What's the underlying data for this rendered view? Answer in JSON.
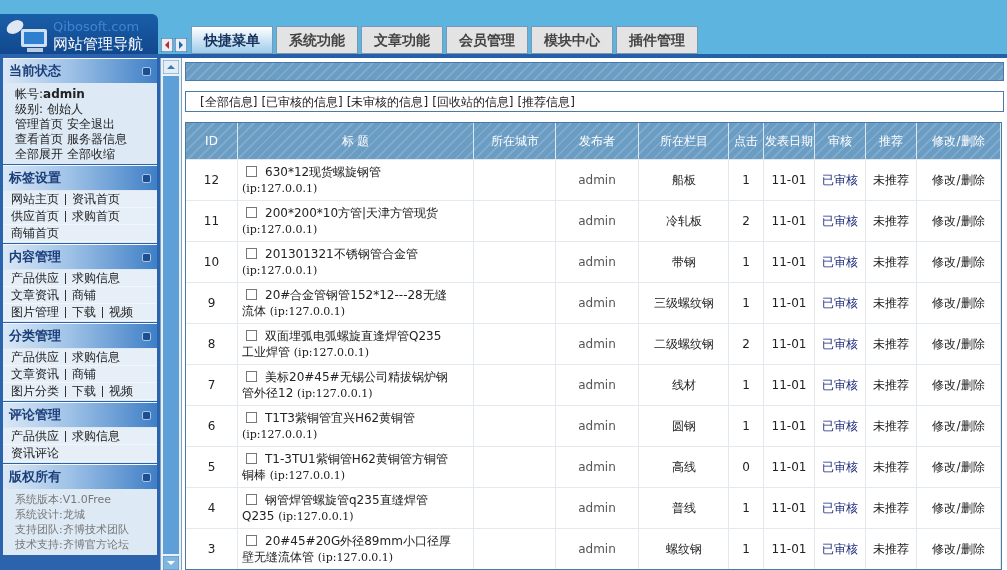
{
  "logo": {
    "site": "Qibosoft.com",
    "title": "网站管理导航"
  },
  "tabs": [
    {
      "label": "快捷菜单",
      "selected": true
    },
    {
      "label": "系统功能",
      "selected": false
    },
    {
      "label": "文章功能",
      "selected": false
    },
    {
      "label": "会员管理",
      "selected": false
    },
    {
      "label": "模块中心",
      "selected": false
    },
    {
      "label": "插件管理",
      "selected": false
    }
  ],
  "sidebar": [
    {
      "title": "当前状态",
      "kind": "info",
      "lines": [
        [
          "帐号:**admin**"
        ],
        [
          "级别: 创始人"
        ],
        [
          "管理首页",
          "安全退出"
        ],
        [
          "查看首页",
          "服务器信息"
        ],
        [
          "全部展开",
          "全部收缩"
        ]
      ]
    },
    {
      "title": "标签设置",
      "kind": "links",
      "lines": [
        [
          "网站主页",
          "资讯首页"
        ],
        [
          "供应首页",
          "求购首页"
        ],
        [
          "商铺首页"
        ]
      ]
    },
    {
      "title": "内容管理",
      "kind": "links",
      "lines": [
        [
          "产品供应",
          "求购信息"
        ],
        [
          "文章资讯",
          "商铺"
        ],
        [
          "图片管理",
          "下载",
          "视频"
        ]
      ]
    },
    {
      "title": "分类管理",
      "kind": "links",
      "lines": [
        [
          "产品供应",
          "求购信息"
        ],
        [
          "文章资讯",
          "商铺"
        ],
        [
          "图片分类",
          "下载",
          "视频"
        ]
      ]
    },
    {
      "title": "评论管理",
      "kind": "links",
      "lines": [
        [
          "产品供应",
          "求购信息"
        ],
        [
          "资讯评论"
        ]
      ]
    },
    {
      "title": "版权所有",
      "kind": "about",
      "lines": [
        [
          "系统版本:V1.0Free"
        ],
        [
          "系统设计:龙城"
        ],
        [
          "支持团队:齐博技术团队"
        ],
        [
          "技术支持:齐博官方论坛"
        ]
      ]
    }
  ],
  "filters": [
    "[全部信息]",
    "[已审核的信息]",
    "[未审核的信息]",
    "[回收站的信息]",
    "[推荐信息]"
  ],
  "table": {
    "columns": [
      "ID",
      "标 题",
      "所在城市",
      "发布者",
      "所在栏目",
      "点击",
      "发表日期",
      "审核",
      "推荐",
      "修改/删除"
    ],
    "rows": [
      {
        "id": "12",
        "checked": false,
        "title": "630*12现货螺旋钢管",
        "ip": "(ip:127.0.0.1)",
        "publisher": "admin",
        "category": "船板",
        "clicks": "1",
        "date": "11-01",
        "review": "已审核",
        "recommend": "未推荐",
        "action": "修改/删除"
      },
      {
        "id": "11",
        "checked": false,
        "title": "200*200*10方管|天津方管现货",
        "ip": "(ip:127.0.0.1)",
        "publisher": "admin",
        "category": "冷轧板",
        "clicks": "2",
        "date": "11-01",
        "review": "已审核",
        "recommend": "未推荐",
        "action": "修改/删除"
      },
      {
        "id": "10",
        "checked": false,
        "title": "201301321不锈钢管合金管",
        "ip": "(ip:127.0.0.1)",
        "publisher": "admin",
        "category": "带钢",
        "clicks": "1",
        "date": "11-01",
        "review": "已审核",
        "recommend": "未推荐",
        "action": "修改/删除"
      },
      {
        "id": "9",
        "checked": false,
        "title": "20#合金管钢管152*12---28无缝流体",
        "ip": "(ip:127.0.0.1)",
        "publisher": "admin",
        "category": "三级螺纹钢",
        "clicks": "1",
        "date": "11-01",
        "review": "已审核",
        "recommend": "未推荐",
        "action": "修改/删除"
      },
      {
        "id": "8",
        "checked": false,
        "title": "双面埋弧电弧螺旋直逢焊管Q235工业焊管",
        "ip": "(ip:127.0.0.1)",
        "publisher": "admin",
        "category": "二级螺纹钢",
        "clicks": "2",
        "date": "11-01",
        "review": "已审核",
        "recommend": "未推荐",
        "action": "修改/删除"
      },
      {
        "id": "7",
        "checked": false,
        "title": "美标20#45#无锡公司精拔锅炉钢管外径12",
        "ip": "(ip:127.0.0.1)",
        "publisher": "admin",
        "category": "线材",
        "clicks": "1",
        "date": "11-01",
        "review": "已审核",
        "recommend": "未推荐",
        "action": "修改/删除"
      },
      {
        "id": "6",
        "checked": false,
        "title": "T1T3紫铜管宜兴H62黄铜管",
        "ip": "(ip:127.0.0.1)",
        "publisher": "admin",
        "category": "圆钢",
        "clicks": "1",
        "date": "11-01",
        "review": "已审核",
        "recommend": "未推荐",
        "action": "修改/删除"
      },
      {
        "id": "5",
        "checked": false,
        "title": "T1-3TU1紫铜管H62黄铜管方铜管铜棒",
        "ip": "(ip:127.0.0.1)",
        "publisher": "admin",
        "category": "高线",
        "clicks": "0",
        "date": "11-01",
        "review": "已审核",
        "recommend": "未推荐",
        "action": "修改/删除"
      },
      {
        "id": "4",
        "checked": false,
        "title": "钢管焊管螺旋管q235直缝焊管Q235",
        "ip": "(ip:127.0.0.1)",
        "publisher": "admin",
        "category": "普线",
        "clicks": "1",
        "date": "11-01",
        "review": "已审核",
        "recommend": "未推荐",
        "action": "修改/删除"
      },
      {
        "id": "3",
        "checked": false,
        "title": "20#45#20G外径89mm小口径厚壁无缝流体管",
        "ip": "(ip:127.0.0.1)",
        "publisher": "admin",
        "category": "螺纹钢",
        "clicks": "1",
        "date": "11-01",
        "review": "已审核",
        "recommend": "未推荐",
        "action": "修改/删除"
      }
    ]
  }
}
